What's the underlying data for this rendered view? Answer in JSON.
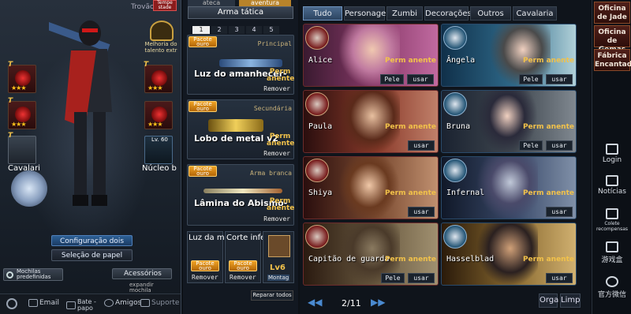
{
  "left": {
    "trovao": "Trovão",
    "tempestade": "Tempe stade",
    "melhoria": "Melhoria do talento extr",
    "t_tags": [
      "T",
      "T",
      "T",
      "T"
    ],
    "stars": [
      "★★★",
      "★★★",
      "★★★",
      "★★★"
    ],
    "cavalaria": "Cavalari",
    "nucleo": "Núcleo b",
    "level": "Lv. 60",
    "config_button": "Configuração dois",
    "role_button": "Seleção de papel",
    "mochilas": "Mochilas predefinidas",
    "acessorios": "Acessórios",
    "expandir": "expandir mochila",
    "bottom": [
      "Email",
      "Bate -papo",
      "Amigos",
      "Suporte"
    ]
  },
  "middle": {
    "top_tabs": [
      "ateca",
      "aventura"
    ],
    "title": "Arma tática",
    "pages": [
      "1",
      "2",
      "3",
      "4",
      "5"
    ],
    "weapons": [
      {
        "badge": "Pacote ouro",
        "slot": "Principal",
        "name": "Luz do amanhecer-",
        "perm": "Perm anente",
        "remove": "Remover"
      },
      {
        "badge": "Pacote ouro",
        "slot": "Secundária",
        "name": "Lobo de metal v2",
        "perm": "Perm anente",
        "remove": "Remover"
      },
      {
        "badge": "Pacote ouro",
        "slot": "Arma branca",
        "name": "Lâmina do Abismo-",
        "perm": "Perm anente",
        "remove": "Remover"
      }
    ],
    "small": [
      {
        "label": "Luz da m",
        "badge": "Pacote ouro",
        "remove": "Remover"
      },
      {
        "label": "Corte infe",
        "badge": "Pacote ouro",
        "remove": "Remover"
      }
    ],
    "lv6": "Lv6",
    "montag": "Montag",
    "repair": "Reparar todos"
  },
  "grid": {
    "tabs": [
      "Tudo",
      "Personage",
      "Zumbi",
      "Decorações",
      "Outros",
      "Cavalaria d"
    ],
    "cards": [
      {
        "name": "Alice",
        "perm": "Perm anente",
        "btns": []
      },
      {
        "name": "Ângela",
        "perm": "Perm anente",
        "btns": [
          "Pele",
          "usar"
        ]
      },
      {
        "name": "Paula",
        "perm": "Perm anente",
        "btns": [
          "usar"
        ]
      },
      {
        "name": "Bruna",
        "perm": "Perm anente",
        "btns": [
          "Pele",
          "usar"
        ]
      },
      {
        "name": "Shiya",
        "perm": "Perm anente",
        "btns": [
          "usar"
        ]
      },
      {
        "name": "Infernal",
        "perm": "Perm anente",
        "btns": [
          "usar"
        ]
      },
      {
        "name": "Capitão de guarda",
        "perm": "Perm anente",
        "btns": [
          "Pele",
          "usar"
        ]
      },
      {
        "name": "Hasselblad",
        "perm": "Perm anente",
        "btns": [
          "usar"
        ]
      }
    ],
    "page": "2/11",
    "prev": "◀◀",
    "next": "▶▶",
    "orga": "Orga",
    "limp": "Limp"
  },
  "side": {
    "oficina_jade": "Oficina de Jade",
    "oficina_gemas": "Oficina de Gemas",
    "fabrica": "Fábrica Encantada",
    "login": "Login",
    "noticias": "Notícias",
    "colete": "Colete recompensas",
    "youxi": "游戏盒",
    "weixin": "官方微信"
  }
}
